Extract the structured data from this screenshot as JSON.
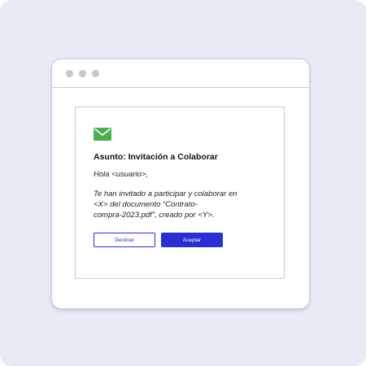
{
  "email": {
    "icon": "envelope-icon",
    "subject": "Asunto: Invitación a Colaborar",
    "greeting": "Hola <usuario>,",
    "body_lines": [
      "Te han invitado a participar y colaborar en",
      "<X> del documento “Contrato-",
      "compra-2023.pdf”, creado por <Y>."
    ],
    "decline_label": "Declinar",
    "accept_label": "Aceptar"
  },
  "colors": {
    "background": "#e7ebf6",
    "accent": "#2b2fd1",
    "icon_green": "#4caf50",
    "window_dots": "#c4c7ce"
  }
}
